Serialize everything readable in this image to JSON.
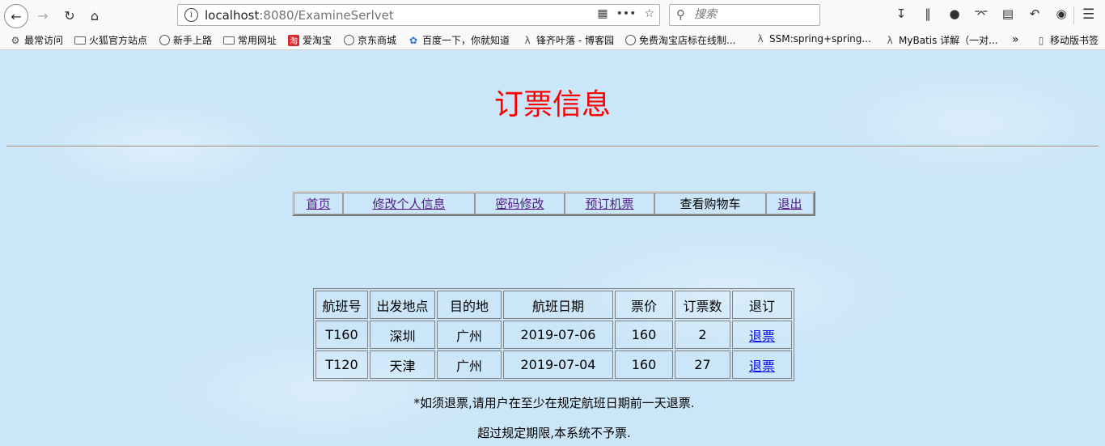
{
  "browser": {
    "url_host": "localhost",
    "url_path": ":8080/ExamineSerlvet",
    "search_placeholder": "搜索",
    "bookmarks": [
      {
        "label": "最常访问",
        "icon": "gear-icon"
      },
      {
        "label": "火狐官方站点",
        "icon": "folder-icon"
      },
      {
        "label": "新手上路",
        "icon": "globe-icon"
      },
      {
        "label": "常用网址",
        "icon": "folder-icon"
      },
      {
        "label": "爱淘宝",
        "icon": "taobao-icon"
      },
      {
        "label": "京东商城",
        "icon": "globe-icon"
      },
      {
        "label": "百度一下，你就知道",
        "icon": "baidu-icon"
      },
      {
        "label": "锋齐叶落 - 博客园",
        "icon": "blog-icon"
      },
      {
        "label": "免费淘宝店标在线制...",
        "icon": "globe-icon"
      },
      {
        "label": "SSM:spring+spring...",
        "icon": "blog-icon"
      },
      {
        "label": "MyBatis 详解（一对...",
        "icon": "blog-icon"
      },
      {
        "label": "移动版书签",
        "icon": "mobile-icon"
      }
    ]
  },
  "page": {
    "title": "订票信息",
    "nav": [
      {
        "label": "首页",
        "link": true
      },
      {
        "label": "修改个人信息",
        "link": true
      },
      {
        "label": "密码修改",
        "link": true
      },
      {
        "label": "预订机票",
        "link": true
      },
      {
        "label": "查看购物车",
        "link": false
      },
      {
        "label": "退出",
        "link": true
      }
    ],
    "table": {
      "headers": [
        "航班号",
        "出发地点",
        "目的地",
        "航班日期",
        "票价",
        "订票数",
        "退订"
      ],
      "rows": [
        [
          "T160",
          "深圳",
          "广州",
          "2019-07-06",
          "160",
          "2",
          "退票"
        ],
        [
          "T120",
          "天津",
          "广州",
          "2019-07-04",
          "160",
          "27",
          "退票"
        ]
      ]
    },
    "note1": "*如须退票,请用户在至少在规定航班日期前一天退票.",
    "note2": "超过规定期限,本系统不予票."
  },
  "colors": {
    "title": "#ff0000",
    "visited_link": "#551a8b",
    "link": "#0000ee",
    "background": "#cbe6f8"
  }
}
